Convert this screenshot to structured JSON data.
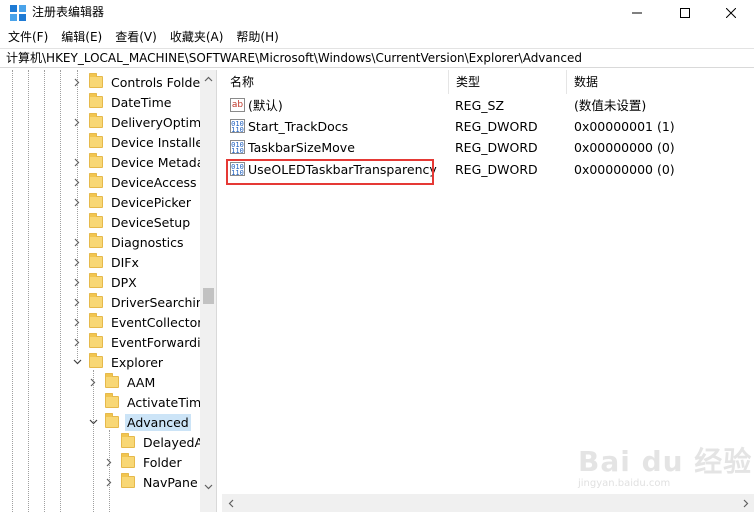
{
  "window": {
    "title": "注册表编辑器",
    "icon": "registry-editor-icon"
  },
  "menu": {
    "items": [
      "文件(F)",
      "编辑(E)",
      "查看(V)",
      "收藏夹(A)",
      "帮助(H)"
    ]
  },
  "address": {
    "path": "计算机\\HKEY_LOCAL_MACHINE\\SOFTWARE\\Microsoft\\Windows\\CurrentVersion\\Explorer\\Advanced"
  },
  "tree": {
    "items": [
      {
        "label": "Controls Folder",
        "expandable": true
      },
      {
        "label": "DateTime",
        "expandable": false
      },
      {
        "label": "DeliveryOptimiza",
        "expandable": true
      },
      {
        "label": "Device Installer",
        "expandable": false
      },
      {
        "label": "Device Metadata",
        "expandable": true
      },
      {
        "label": "DeviceAccess",
        "expandable": true
      },
      {
        "label": "DevicePicker",
        "expandable": true
      },
      {
        "label": "DeviceSetup",
        "expandable": false
      },
      {
        "label": "Diagnostics",
        "expandable": true
      },
      {
        "label": "DIFx",
        "expandable": true
      },
      {
        "label": "DPX",
        "expandable": true
      },
      {
        "label": "DriverSearching",
        "expandable": true
      },
      {
        "label": "EventCollector",
        "expandable": true
      },
      {
        "label": "EventForwarding",
        "expandable": true
      },
      {
        "label": "Explorer",
        "expanded": true
      },
      {
        "label": "AAM",
        "expandable": true
      },
      {
        "label": "ActivateTimec",
        "expandable": false
      },
      {
        "label": "Advanced",
        "expanded": true,
        "selected": true
      },
      {
        "label": "DelayedAp",
        "expandable": false
      },
      {
        "label": "Folder",
        "expandable": true
      },
      {
        "label": "NavPane",
        "expandable": true
      }
    ]
  },
  "list": {
    "columns": [
      "名称",
      "类型",
      "数据"
    ],
    "rows": [
      {
        "icon": "string-value-icon",
        "name": "(默认)",
        "type": "REG_SZ",
        "data": "(数值未设置)"
      },
      {
        "icon": "dword-value-icon",
        "name": "Start_TrackDocs",
        "type": "REG_DWORD",
        "data": "0x00000001 (1)"
      },
      {
        "icon": "dword-value-icon",
        "name": "TaskbarSizeMove",
        "type": "REG_DWORD",
        "data": "0x00000000 (0)"
      },
      {
        "icon": "dword-value-icon",
        "name": "UseOLEDTaskbarTransparency",
        "type": "REG_DWORD",
        "data": "0x00000000 (0)",
        "highlighted": true
      }
    ]
  },
  "watermark": {
    "text": "Bai du 经验",
    "sub": "jingyan.baidu.com"
  },
  "colors": {
    "selection": "#cce4f7",
    "highlight_box": "#e53935",
    "folder": "#f8d775"
  }
}
